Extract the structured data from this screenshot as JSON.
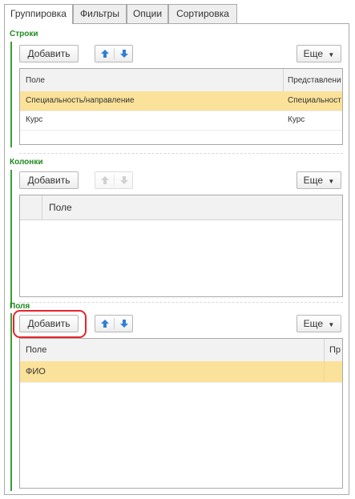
{
  "tabs": [
    {
      "label": "Группировка",
      "active": true
    },
    {
      "label": "Фильтры",
      "active": false
    },
    {
      "label": "Опции",
      "active": false
    },
    {
      "label": "Сортировка",
      "active": false
    }
  ],
  "rows_section": {
    "title": "Строки",
    "add_label": "Добавить",
    "more_label": "Еще",
    "columns": [
      "Поле",
      "Представлени"
    ],
    "rows": [
      {
        "field": "Специальность/направление",
        "presentation": "Специальност",
        "selected": true
      },
      {
        "field": "Курс",
        "presentation": "Курс",
        "selected": false
      }
    ]
  },
  "columns_section": {
    "title": "Колонки",
    "add_label": "Добавить",
    "more_label": "Еще",
    "columns": [
      "Поле"
    ]
  },
  "fields_section": {
    "title": "Поля",
    "add_label": "Добавить",
    "more_label": "Еще",
    "columns": [
      "Поле",
      "Пр"
    ],
    "rows": [
      {
        "field": "ФИО",
        "selected": true
      }
    ]
  },
  "icons": {
    "move_up": "arrow-up-icon",
    "move_down": "arrow-down-icon",
    "more_dropdown": "chevron-down-icon"
  },
  "colors": {
    "accent_green": "#1f8a1f",
    "selection": "#fbe29a",
    "arrow_blue": "#2f7fd6",
    "annotation_red": "#e5242b"
  }
}
